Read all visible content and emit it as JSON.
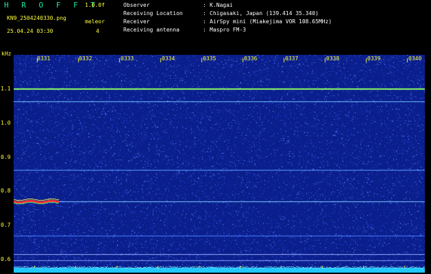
{
  "header": {
    "app_title": "H R O F F T",
    "version": "1.0.0f",
    "filename": "KN9_2504240330.png",
    "mode_label": "meleor",
    "mode_value": "4",
    "datetime": "25.04.24 03:30"
  },
  "info": [
    {
      "label": "Observer",
      "value": "K.Nagai"
    },
    {
      "label": "Receiving Location",
      "value": "Chigasaki, Japan (139.414 35.340)"
    },
    {
      "label": "Receiver",
      "value": "AirSpy mini (Miakejima VOR 108.65MHz)"
    },
    {
      "label": "Receiving antenna",
      "value": "Maspro FM-3"
    }
  ],
  "axis": {
    "unit": "kHz",
    "y_ticks": [
      "1.1",
      "1.0",
      "0.9",
      "0.8",
      "0.7",
      "0.6"
    ],
    "x_ticks": [
      "0331",
      "0332",
      "0333",
      "0334",
      "0335",
      "0336",
      "0337",
      "0338",
      "0339",
      "0340"
    ]
  },
  "colors": {
    "background": "#0a1e8c",
    "noise": "#4a6cff",
    "carrier": "#8cff60",
    "meteor": "#ff3030",
    "label": "#ffff3a"
  }
}
